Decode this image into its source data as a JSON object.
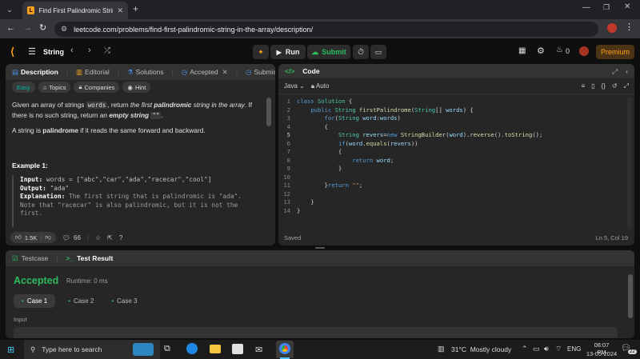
{
  "browser": {
    "tab_title": "Find First Palindromic String in t",
    "url": "leetcode.com/problems/find-first-palindromic-string-in-the-array/description/"
  },
  "leetcode_nav": {
    "problem_list": "String",
    "run_label": "Run",
    "submit_label": "Submit",
    "streak_count": "0",
    "premium_label": "Premium"
  },
  "left_tabs": {
    "description": "Description",
    "editorial": "Editorial",
    "solutions": "Solutions",
    "accepted": "Accepted",
    "submissions": "Submissions"
  },
  "tags": {
    "difficulty": "Easy",
    "topics": "Topics",
    "companies": "Companies",
    "hint": "Hint"
  },
  "description": {
    "p1_a": "Given an array of strings ",
    "p1_code1": "words",
    "p1_b": ", return ",
    "p1_em1": "the first ",
    "p1_strong1": "palindromic",
    "p1_em2": " string in the array",
    "p1_c": ". If there is no such string, return ",
    "p1_em3": "an ",
    "p1_strong2": "empty string",
    "p1_code2": "\"\"",
    "p1_d": ".",
    "p2_a": "A string is ",
    "p2_strong": "palindrome",
    "p2_b": " if it reads the same forward and backward.",
    "example_title": "Example 1:",
    "ex_input_label": "Input:",
    "ex_input": "words = [\"abc\",\"car\",\"ada\",\"racecar\",\"cool\"]",
    "ex_output_label": "Output:",
    "ex_output": "\"ada\"",
    "ex_expl_label": "Explanation:",
    "ex_expl": "The first string that is palindromic is \"ada\". Note that \"racecar\" is also palindromic, but it is not the first."
  },
  "bottom_bar": {
    "likes": "1.5K",
    "comments": "66"
  },
  "code_panel": {
    "title": "Code",
    "language": "Java",
    "mode": "Auto",
    "status": "Saved",
    "cursor": "Ln 5, Col 19"
  },
  "code_lines": [
    "1",
    "2",
    "3",
    "4",
    "5",
    "6",
    "7",
    "8",
    "9",
    "10",
    "11",
    "12",
    "13",
    "14"
  ],
  "test_panel": {
    "testcase_tab": "Testcase",
    "result_tab": "Test Result",
    "verdict": "Accepted",
    "runtime": "Runtime: 0 ms",
    "cases": [
      "Case 1",
      "Case 2",
      "Case 3"
    ],
    "input_label": "Input"
  },
  "taskbar": {
    "search_placeholder": "Type here to search",
    "weather": "31°C  Mostly cloudy",
    "lang": "ENG",
    "time": "08:07 PM",
    "date": "13-05-2024",
    "notif_count": "22"
  },
  "colors": {
    "accent_green": "#2cbb5d",
    "easy": "#00b8a3",
    "premium": "#ffa116",
    "accepted": "#2cbb5d"
  }
}
